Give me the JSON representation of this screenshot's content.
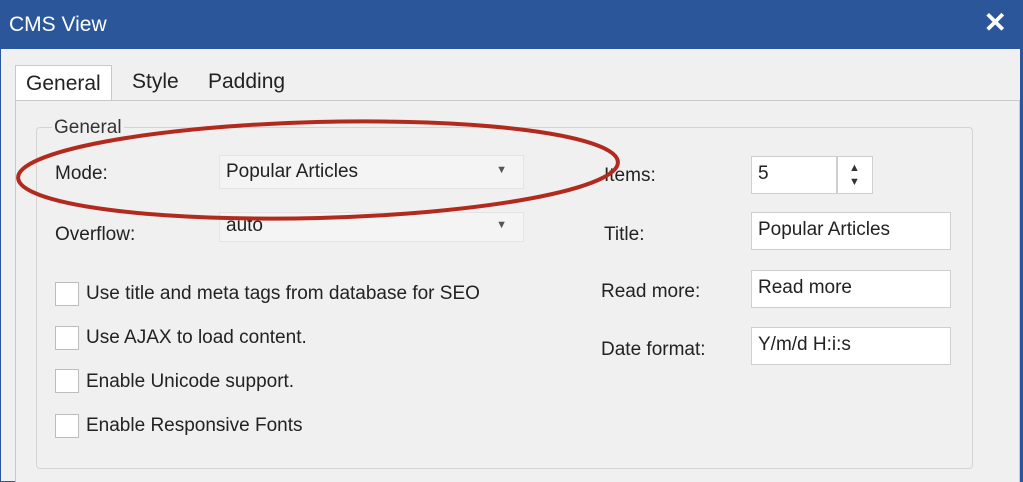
{
  "window": {
    "title": "CMS View",
    "close_glyph": "✕"
  },
  "tabs": [
    {
      "label": "General",
      "active": true
    },
    {
      "label": "Style",
      "active": false
    },
    {
      "label": "Padding",
      "active": false
    }
  ],
  "group": {
    "legend": "General"
  },
  "mode": {
    "label": "Mode:",
    "value": "Popular Articles"
  },
  "overflow": {
    "label": "Overflow:",
    "value": "auto"
  },
  "checkboxes": [
    {
      "label": "Use title and meta tags from database for SEO",
      "checked": false
    },
    {
      "label": "Use AJAX to load content.",
      "checked": false
    },
    {
      "label": "Enable Unicode support.",
      "checked": false
    },
    {
      "label": "Enable Responsive Fonts",
      "checked": false
    }
  ],
  "items": {
    "label": "Items:",
    "value": "5"
  },
  "title_field": {
    "label": "Title:",
    "value": "Popular Articles"
  },
  "read_more": {
    "label": "Read more:",
    "value": "Read more"
  },
  "date_format": {
    "label": "Date format:",
    "value": "Y/m/d H:i:s"
  },
  "colors": {
    "titlebar": "#2b579a",
    "annotation_oval": "#b22a1e",
    "dialog_bg": "#f0f0f0"
  },
  "icons": {
    "dropdown": "chevron-down-icon",
    "spin_up": "triangle-up-icon",
    "spin_down": "triangle-down-icon",
    "close": "close-icon"
  }
}
